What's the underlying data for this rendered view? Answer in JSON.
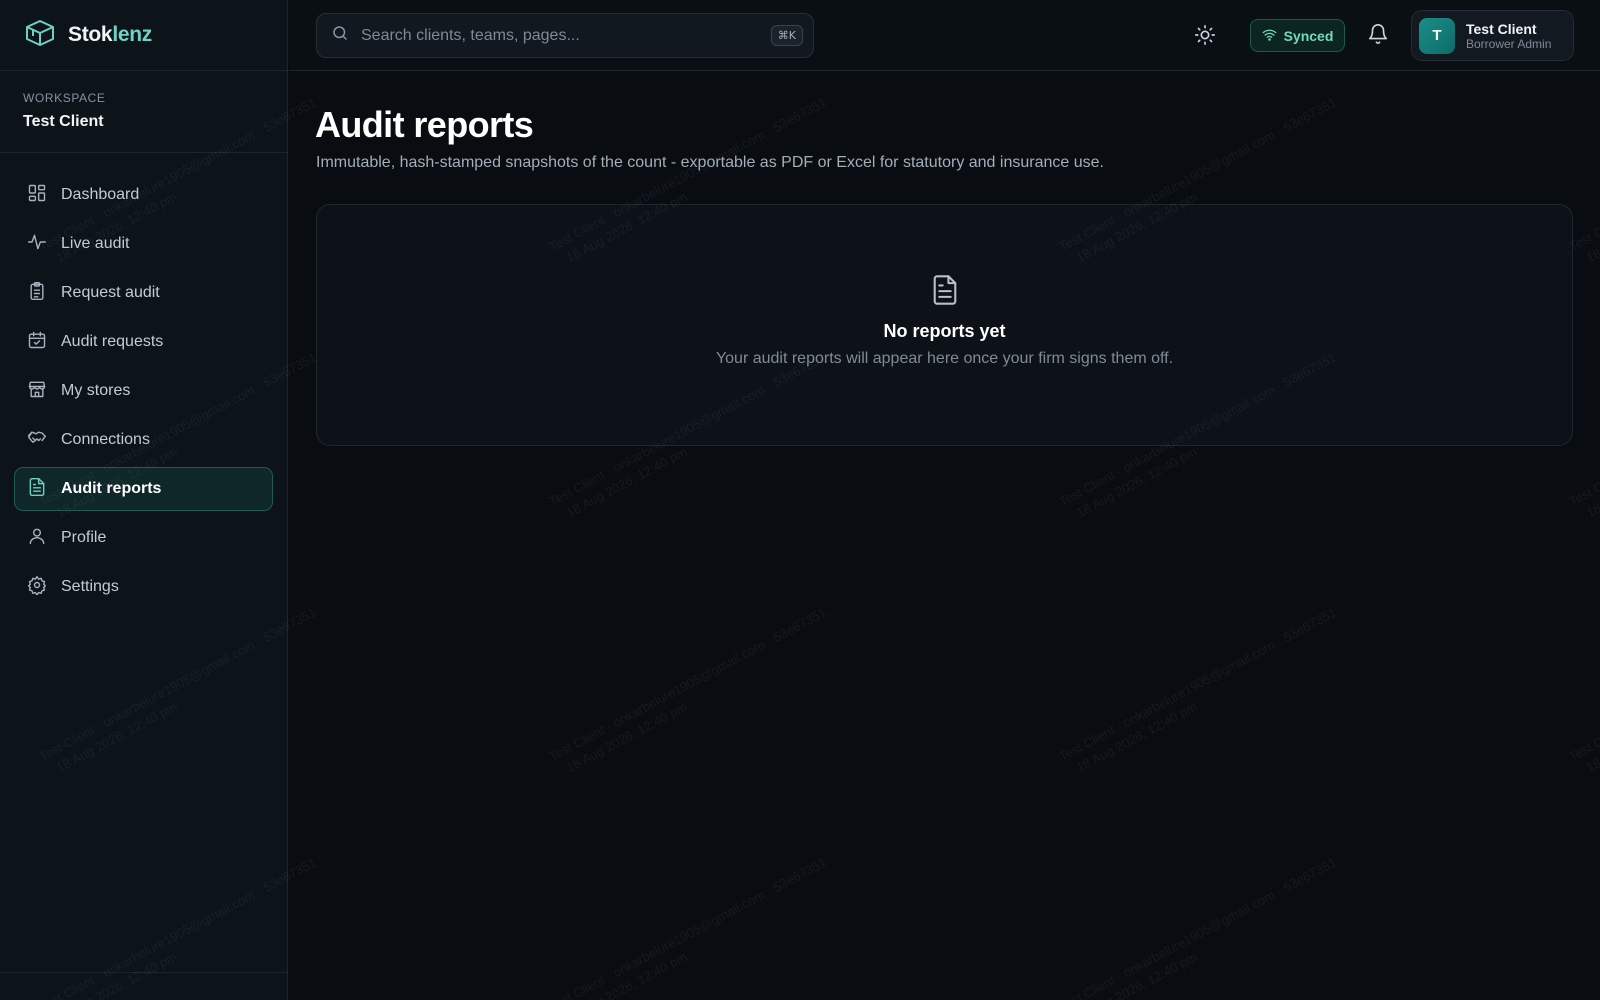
{
  "brand": {
    "name_part1": "Stok",
    "name_part2": "lenz"
  },
  "workspace": {
    "label": "WORKSPACE",
    "name": "Test Client"
  },
  "sidebar": {
    "items": [
      {
        "label": "Dashboard",
        "icon": "dashboard-grid-icon",
        "active": false
      },
      {
        "label": "Live audit",
        "icon": "activity-pulse-icon",
        "active": false
      },
      {
        "label": "Request audit",
        "icon": "clipboard-list-icon",
        "active": false
      },
      {
        "label": "Audit requests",
        "icon": "calendar-check-icon",
        "active": false
      },
      {
        "label": "My stores",
        "icon": "store-icon",
        "active": false
      },
      {
        "label": "Connections",
        "icon": "handshake-icon",
        "active": false
      },
      {
        "label": "Audit reports",
        "icon": "file-text-icon",
        "active": true
      },
      {
        "label": "Profile",
        "icon": "user-icon",
        "active": false
      },
      {
        "label": "Settings",
        "icon": "gear-icon",
        "active": false
      }
    ]
  },
  "search": {
    "placeholder": "Search clients, teams, pages...",
    "shortcut": "⌘K"
  },
  "topbar": {
    "sync_label": "Synced"
  },
  "user": {
    "initial": "T",
    "name": "Test Client",
    "role": "Borrower Admin"
  },
  "page": {
    "title": "Audit reports",
    "subtitle": "Immutable, hash-stamped snapshots of the count - exportable as PDF or Excel for statutory and insurance use."
  },
  "empty_state": {
    "title": "No reports yet",
    "message": "Your audit reports will appear here once your firm signs them off."
  },
  "watermark": {
    "line1": "Test Client · onkarbelure1905@gmail.com · 53e67351",
    "line2": "18 Aug 2026, 12:40 pm"
  },
  "colors": {
    "accent": "#6fd1c4",
    "synced": "#74d9b9",
    "background": "#090d12"
  }
}
